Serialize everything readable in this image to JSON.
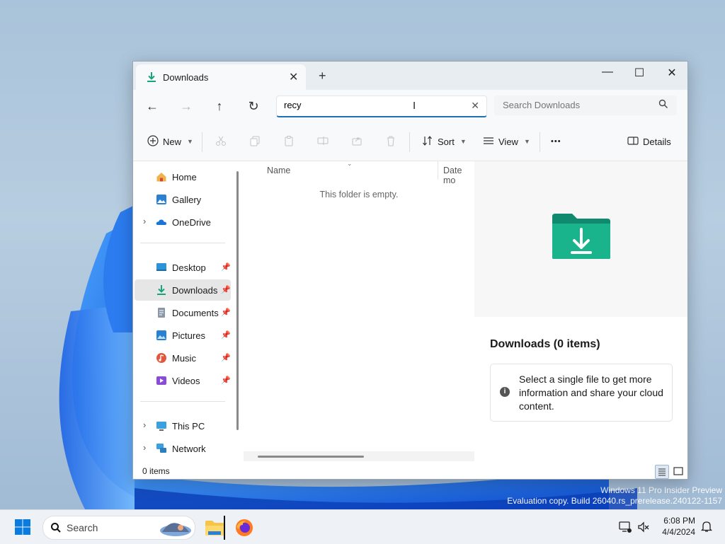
{
  "watermark": {
    "line1": "Windows 11 Pro Insider Preview",
    "line2": "Evaluation copy. Build 26040.rs_prerelease.240122-1157"
  },
  "titlebar": {
    "tab_label": "Downloads",
    "tab_close": "✕",
    "new_tab": "+",
    "minimize": "—",
    "maximize": "☐",
    "close": "✕"
  },
  "nav": {
    "back": "←",
    "forward": "→",
    "up": "↑",
    "refresh": "↻",
    "address_value": "recy",
    "address_clear": "✕",
    "search_placeholder": "Search Downloads"
  },
  "toolbar": {
    "new_label": "New",
    "sort_label": "Sort",
    "view_label": "View",
    "more": "•••",
    "details_label": "Details"
  },
  "sidebar": {
    "top": [
      {
        "label": "Home"
      },
      {
        "label": "Gallery"
      },
      {
        "label": "OneDrive"
      }
    ],
    "quick": [
      {
        "label": "Desktop"
      },
      {
        "label": "Downloads"
      },
      {
        "label": "Documents"
      },
      {
        "label": "Pictures"
      },
      {
        "label": "Music"
      },
      {
        "label": "Videos"
      }
    ],
    "bottom": [
      {
        "label": "This PC"
      },
      {
        "label": "Network"
      }
    ]
  },
  "list": {
    "col_name": "Name",
    "col_date": "Date mo",
    "empty_text": "This folder is empty."
  },
  "details": {
    "title": "Downloads (0 items)",
    "info_text": "Select a single file to get more information and share your cloud content."
  },
  "status": {
    "count": "0 items"
  },
  "taskbar": {
    "search_label": "Search",
    "time": "6:08 PM",
    "date": "4/4/2024"
  },
  "colors": {
    "accent": "#1f6fb5",
    "download_green": "#1aa27b",
    "folder_teal": "#16a085"
  }
}
